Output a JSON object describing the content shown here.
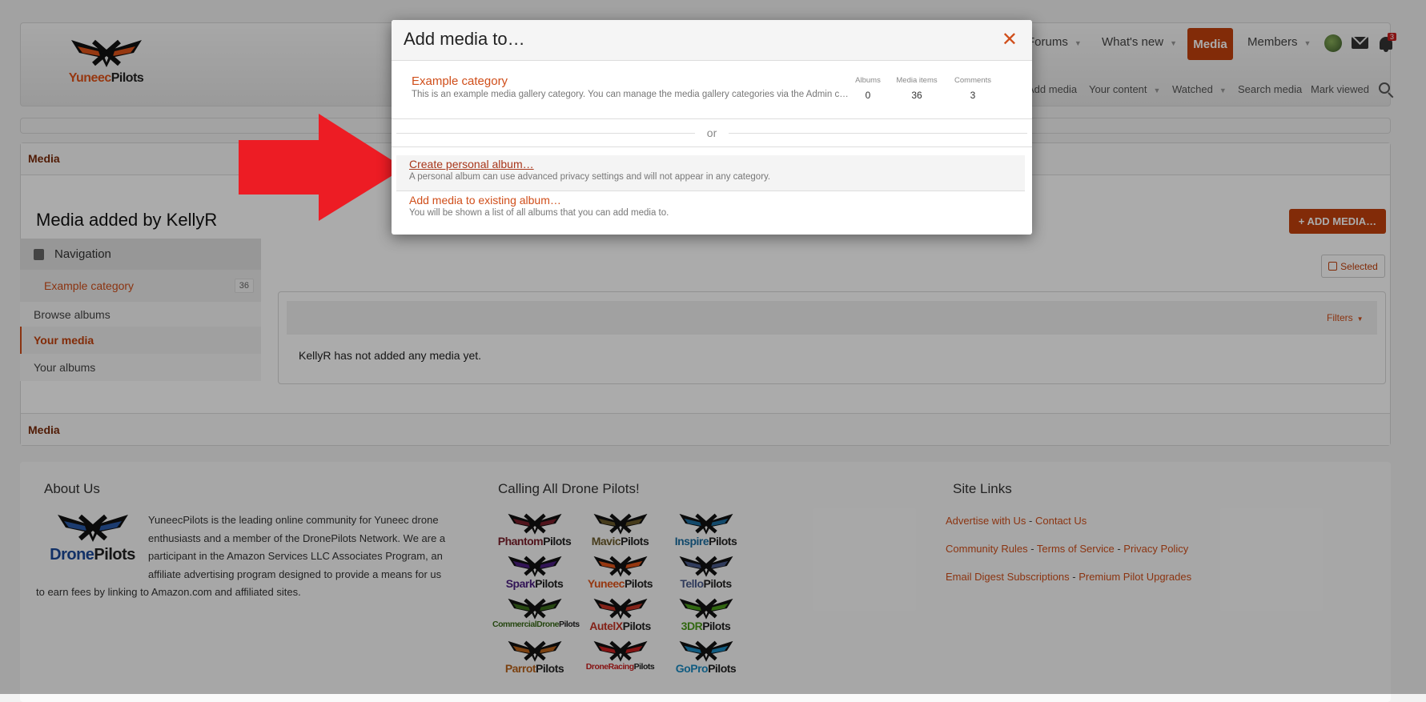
{
  "header": {
    "logo": {
      "brand_a": "Yuneec",
      "brand_b": "Pilots"
    },
    "nav": [
      {
        "label": "Forums",
        "caret": true
      },
      {
        "label": "What's new",
        "caret": true
      },
      {
        "label": "Media",
        "active": true
      },
      {
        "label": "Members",
        "caret": true
      }
    ],
    "notification_count": "3",
    "subnav": [
      {
        "label": "Add media"
      },
      {
        "label": "Your content",
        "caret": true
      },
      {
        "label": "Watched",
        "caret": true
      },
      {
        "label": "Search media"
      },
      {
        "label": "Mark viewed"
      }
    ],
    "icons": {
      "avatar": "avatar",
      "mail": "envelope-icon",
      "bell": "bell-icon",
      "search": "search-icon"
    }
  },
  "breadcrumb": {
    "top": "Media",
    "bottom": "Media"
  },
  "page": {
    "title": "Media added by KellyR",
    "add_media_button": "+ ADD MEDIA…",
    "selected_button": "Selected",
    "filters_label": "Filters",
    "empty_message": "KellyR has not added any media yet."
  },
  "sidebar": {
    "heading": "Navigation",
    "items": [
      {
        "label": "Example category",
        "count": "36"
      },
      {
        "label": "Browse albums"
      },
      {
        "label": "Your media",
        "active": true
      },
      {
        "label": "Your albums"
      }
    ]
  },
  "modal": {
    "title": "Add media to…",
    "category": {
      "name": "Example category",
      "description": "This is an example media gallery category. You can manage the media gallery categories via the Admin c…",
      "stats": [
        {
          "label": "Albums",
          "value": "0"
        },
        {
          "label": "Media items",
          "value": "36"
        },
        {
          "label": "Comments",
          "value": "3"
        }
      ]
    },
    "separator": "or",
    "options": [
      {
        "label": "Create personal album…",
        "description": "A personal album can use advanced privacy settings and will not appear in any category."
      },
      {
        "label": "Add media to existing album…",
        "description": "You will be shown a list of all albums that you can add media to."
      }
    ]
  },
  "footer": {
    "about": {
      "heading": "About Us",
      "logo": {
        "brand_a": "Drone",
        "brand_b": "Pilots"
      },
      "text": "YuneecPilots is the leading online community for Yuneec drone enthusiasts and a member of the DronePilots Network. We are a participant in the Amazon Services LLC Associates Program, an affiliate advertising program designed to provide a means for us to earn fees by linking to Amazon.com and affiliated sites."
    },
    "network": {
      "heading": "Calling All Drone Pilots!",
      "sites": [
        {
          "a": "Phantom",
          "b": "Pilots",
          "color": "#7a1f2b"
        },
        {
          "a": "Mavic",
          "b": "Pilots",
          "color": "#6b5a2a"
        },
        {
          "a": "Inspire",
          "b": "Pilots",
          "color": "#1c6ea0"
        },
        {
          "a": "Spark",
          "b": "Pilots",
          "color": "#4b1f80"
        },
        {
          "a": "Yuneec",
          "b": "Pilots",
          "color": "#e0541a"
        },
        {
          "a": "Tello",
          "b": "Pilots",
          "color": "#4a5a8a"
        },
        {
          "a": "CommercialDrone",
          "b": "Pilots",
          "color": "#3a6a1a"
        },
        {
          "a": "AutelX",
          "b": "Pilots",
          "color": "#c43324"
        },
        {
          "a": "3DR",
          "b": "Pilots",
          "color": "#4a9a1a"
        },
        {
          "a": "Parrot",
          "b": "Pilots",
          "color": "#b8621a"
        },
        {
          "a": "DroneRacing",
          "b": "Pilots",
          "color": "#c81e1e"
        },
        {
          "a": "GoPro",
          "b": "Pilots",
          "color": "#1a8ac0"
        }
      ]
    },
    "links": {
      "heading": "Site Links",
      "rows": [
        [
          "Advertise with Us",
          "Contact Us"
        ],
        [
          "Community Rules",
          "Terms of Service",
          "Privacy Policy"
        ],
        [
          "Email Digest Subscriptions",
          "Premium Pilot Upgrades"
        ]
      ]
    }
  },
  "colors": {
    "accent": "#d04e1a",
    "media_button": "#c2410c",
    "arrow": "#ed1c24"
  }
}
